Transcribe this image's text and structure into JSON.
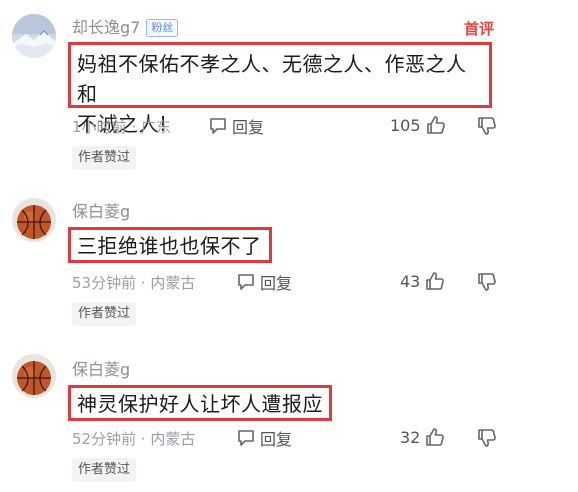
{
  "comments": [
    {
      "username": "却长逸g7",
      "badge": "粉丝",
      "first_tag": "首评",
      "text_line1": "妈祖不保佑不孝之人、无德之人、作恶之人和",
      "text_line2": "不诚之人!",
      "meta": "1小时前 · 广东",
      "reply_label": "回复",
      "likes": "105",
      "author_tag": "作者赞过",
      "avatar": "snow-mountain-avatar"
    },
    {
      "username": "保白菱g",
      "text_line1": "三拒绝谁也也保不了",
      "meta": "53分钟前 · 内蒙古",
      "reply_label": "回复",
      "likes": "43",
      "author_tag": "作者赞过",
      "avatar": "basketball-avatar"
    },
    {
      "username": "保白菱g",
      "text_line1": "神灵保护好人让坏人遭报应",
      "meta": "52分钟前 · 内蒙古",
      "reply_label": "回复",
      "likes": "32",
      "author_tag": "作者赞过",
      "avatar": "basketball-avatar"
    }
  ],
  "colors": {
    "highlight_border": "#e03a3e",
    "first_tag": "#f04142",
    "meta_text": "#9aa0a6"
  }
}
